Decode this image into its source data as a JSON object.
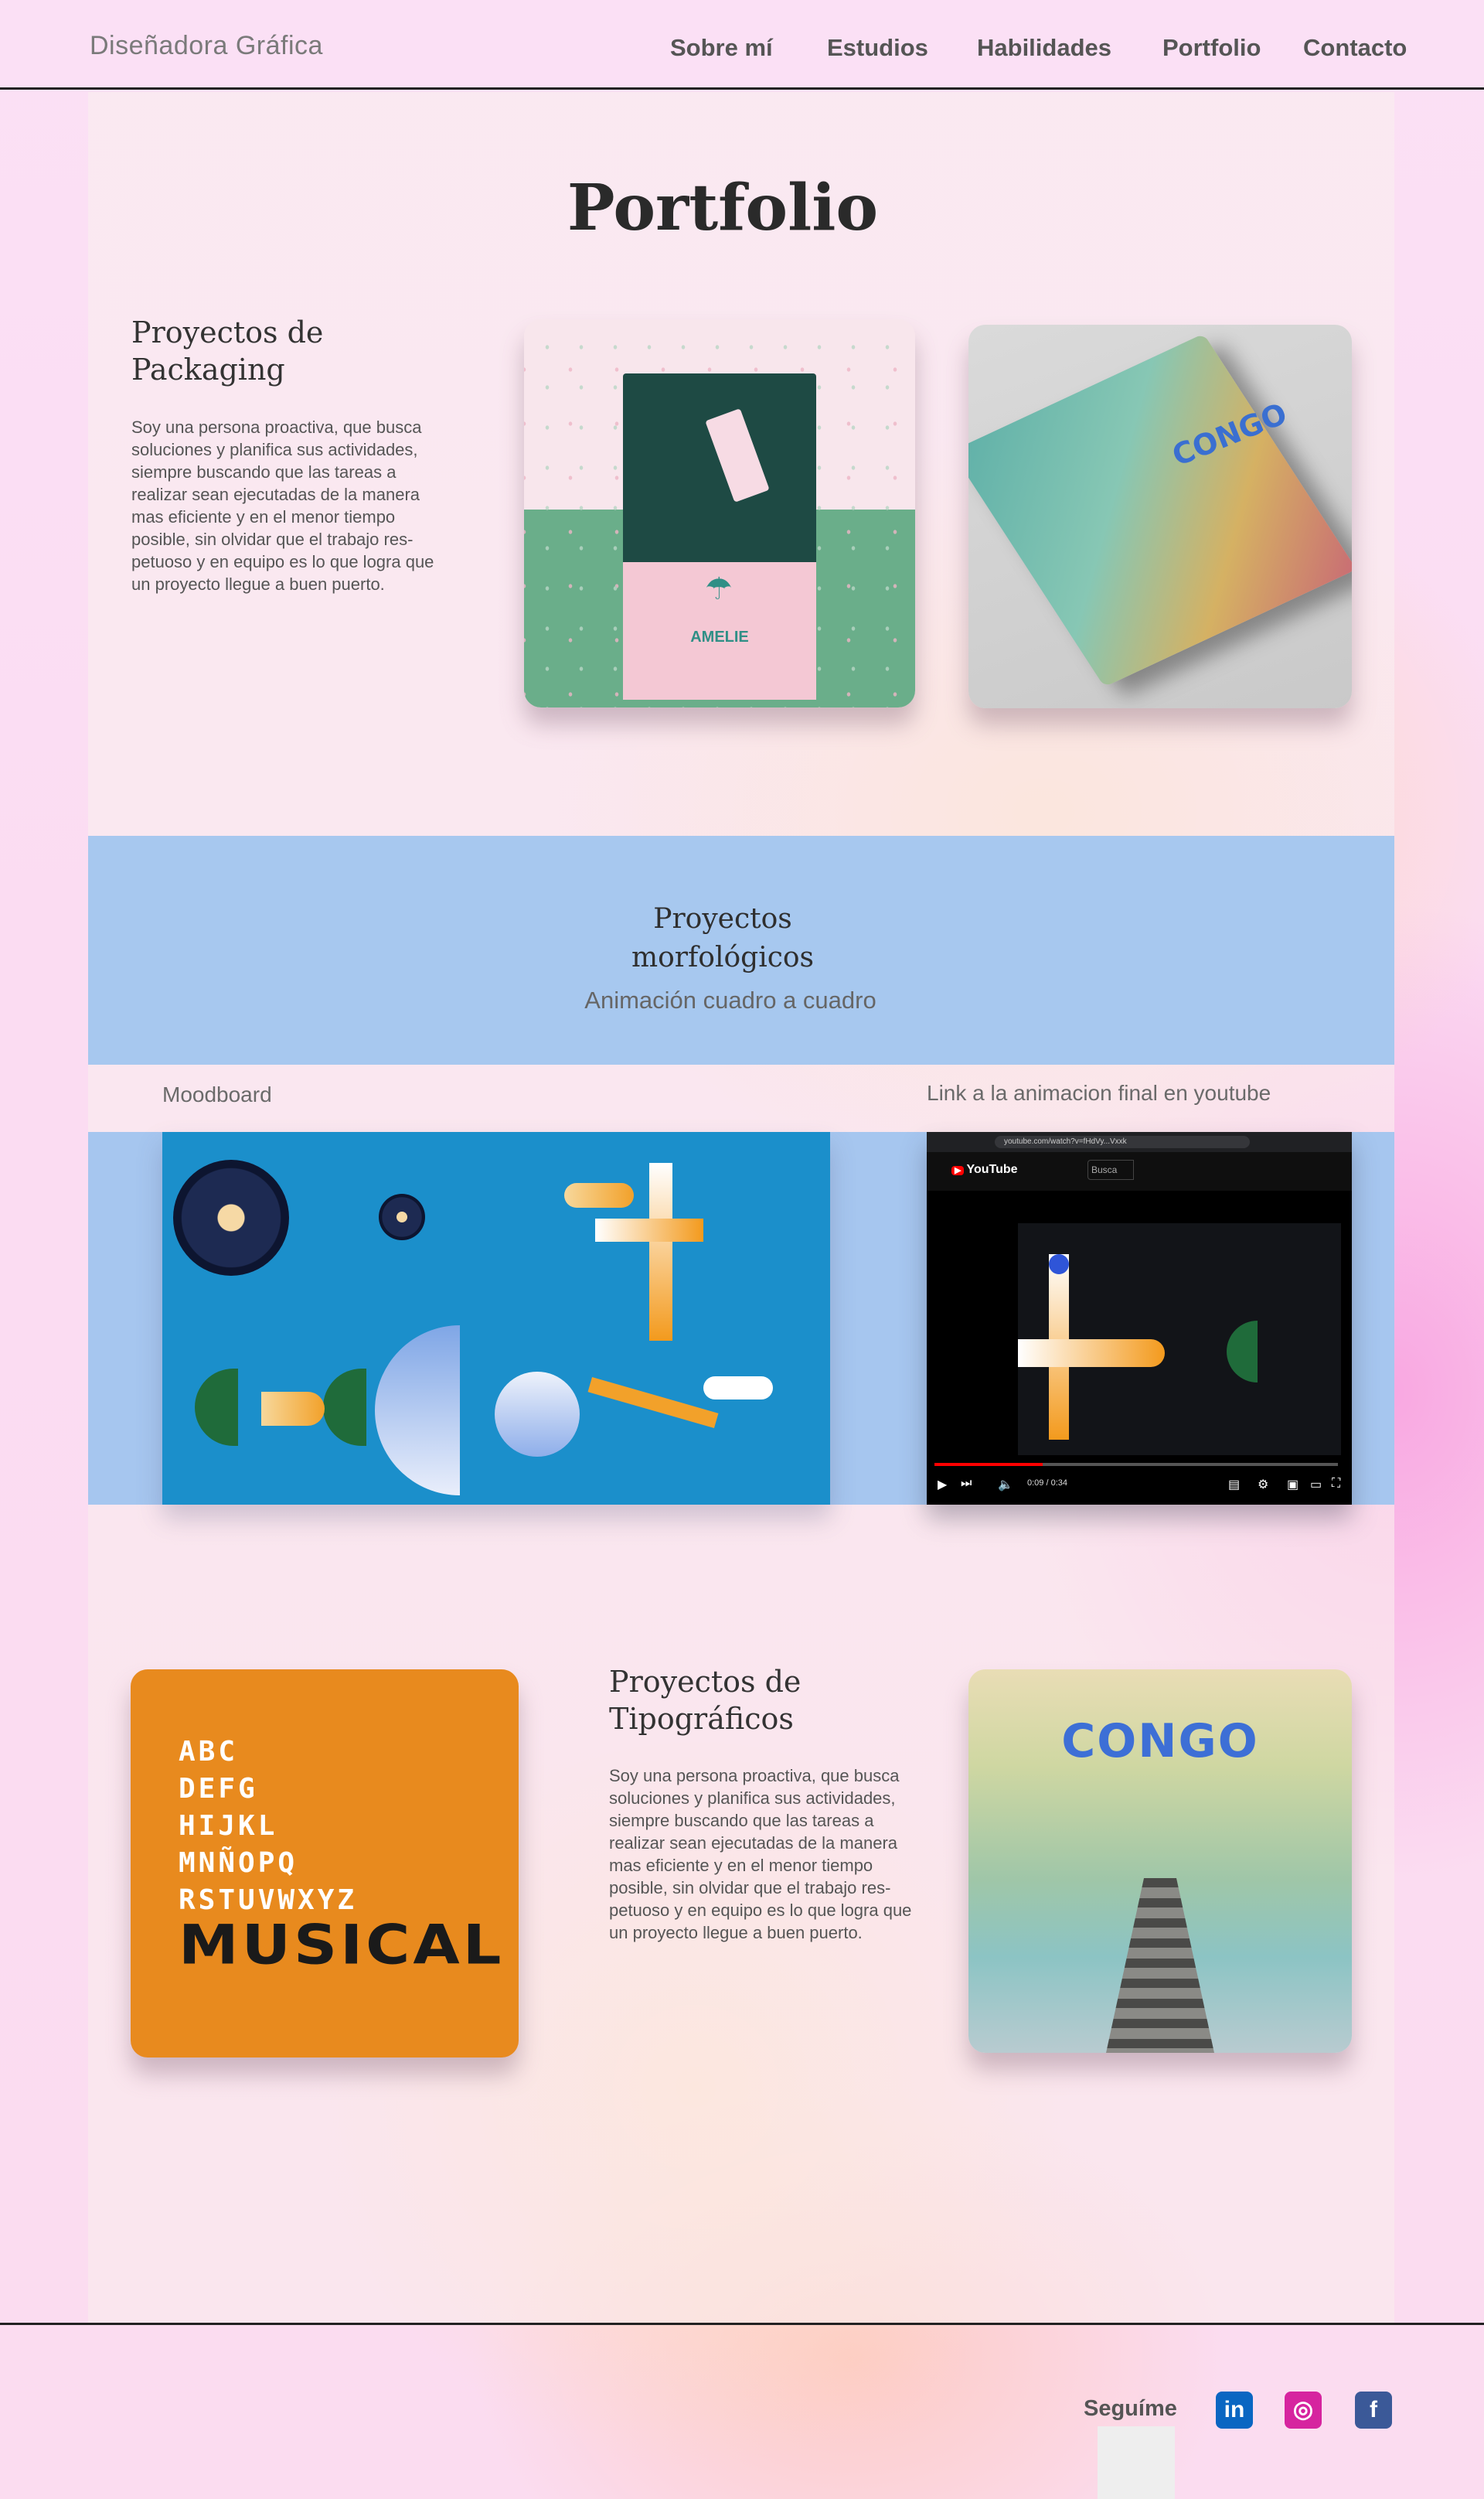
{
  "header": {
    "brand": "Diseñadora Gráfica",
    "nav": [
      {
        "label": "Sobre mí"
      },
      {
        "label": "Estudios"
      },
      {
        "label": "Habilidades"
      },
      {
        "label": "Portfolio"
      },
      {
        "label": "Contacto"
      }
    ]
  },
  "page": {
    "title": "Portfolio"
  },
  "packaging": {
    "title_line1": "Proyectos de",
    "title_line2": "Packaging",
    "text": "Soy una persona proactiva, que busca soluciones y planifica sus actividades, siempre buscando que las tareas a realizar sean ejecutadas de la manera mas eficiente y en el menor tiempo posible, sin olvidar que el trabajo res- petuoso y en equipo es lo que logra que un proyecto llegue a buen puerto.",
    "image1_brand": "AMELIE",
    "image2_brand": "CONGO"
  },
  "morphology": {
    "title_line1": "Proyectos",
    "title_line2": "morfológicos",
    "subtitle": "Animación cuadro a cuadro",
    "moodboard_label": "Moodboard",
    "youtube_label": "Link a la animacion final en youtube",
    "youtube": {
      "url": "youtube.com/watch?v=fHdVy...Vxxk",
      "logo": "YouTube",
      "search_placeholder": "Busca",
      "time": "0:09 / 0:34"
    }
  },
  "typography": {
    "title_line1": "Proyectos de",
    "title_line2": "Tipográficos",
    "text": "Soy una persona proactiva, que busca soluciones y planifica sus actividades, siempre buscando que las tareas a realizar sean ejecutadas de la manera mas eficiente y en el menor tiempo posible, sin olvidar que el trabajo res- petuoso y en equipo es lo que logra que un proyecto llegue a buen puerto.",
    "card_rows": [
      "ABC",
      "DEFG",
      "HIJKL",
      "MNÑOPQ",
      "RSTUVWXYZ"
    ],
    "card_word": "MUSICAL",
    "poster_title": "CONGO"
  },
  "footer": {
    "follow_label": "Seguíme",
    "social": [
      {
        "name": "linkedin-icon",
        "glyph": "in",
        "color": "#0a66c2"
      },
      {
        "name": "instagram-icon",
        "glyph": "◎",
        "color": "#d6249f"
      },
      {
        "name": "facebook-icon",
        "glyph": "f",
        "color": "#3b5998"
      }
    ]
  },
  "colors": {
    "band_blue": "#a7c8ef",
    "typo_orange": "#e88a1e",
    "moodboard_blue": "#1b8fcb"
  }
}
